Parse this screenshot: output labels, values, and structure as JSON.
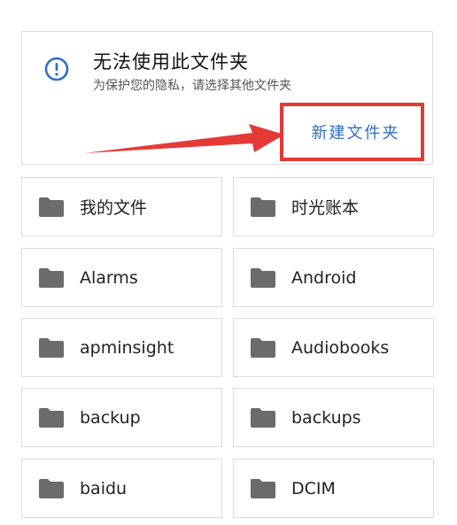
{
  "notice": {
    "icon": "info-icon",
    "title": "无法使用此文件夹",
    "subtitle": "为保护您的隐私，请选择其他文件夹",
    "new_folder_label": "新建文件夹",
    "accent_color": "#2f6fbf",
    "highlight_color": "#e53935"
  },
  "folders": [
    {
      "label": "我的文件",
      "icon": "folder-icon"
    },
    {
      "label": "时光账本",
      "icon": "folder-icon"
    },
    {
      "label": "Alarms",
      "icon": "folder-icon"
    },
    {
      "label": "Android",
      "icon": "folder-icon"
    },
    {
      "label": "apminsight",
      "icon": "folder-icon"
    },
    {
      "label": "Audiobooks",
      "icon": "folder-icon"
    },
    {
      "label": "backup",
      "icon": "folder-icon"
    },
    {
      "label": "backups",
      "icon": "folder-icon"
    },
    {
      "label": "baidu",
      "icon": "folder-icon"
    },
    {
      "label": "DCIM",
      "icon": "folder-icon"
    }
  ]
}
